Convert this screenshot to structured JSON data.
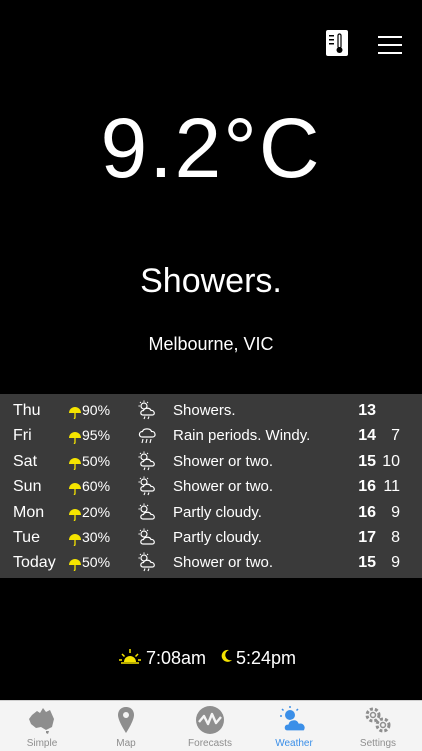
{
  "current": {
    "temperature": "9.2°C",
    "condition": "Showers.",
    "location": "Melbourne, VIC"
  },
  "colors": {
    "accent": "#3b8fe8",
    "umbrella": "#f5e400",
    "forecast_bg": "#3a3a3a"
  },
  "forecast": [
    {
      "day": "Thu",
      "rain": "90%",
      "icon": "showers-icon",
      "desc": "Showers.",
      "max": "13",
      "min": ""
    },
    {
      "day": "Fri",
      "rain": "95%",
      "icon": "rain-icon",
      "desc": "Rain periods. Windy.",
      "max": "14",
      "min": "7"
    },
    {
      "day": "Sat",
      "rain": "50%",
      "icon": "showers-icon",
      "desc": "Shower or two.",
      "max": "15",
      "min": "10"
    },
    {
      "day": "Sun",
      "rain": "60%",
      "icon": "showers-icon",
      "desc": "Shower or two.",
      "max": "16",
      "min": "11"
    },
    {
      "day": "Mon",
      "rain": "20%",
      "icon": "partly-cloudy-icon",
      "desc": "Partly cloudy.",
      "max": "16",
      "min": "9"
    },
    {
      "day": "Tue",
      "rain": "30%",
      "icon": "partly-cloudy-icon",
      "desc": "Partly cloudy.",
      "max": "17",
      "min": "8"
    },
    {
      "day": "Today",
      "rain": "50%",
      "icon": "showers-icon",
      "desc": "Shower or two.",
      "max": "15",
      "min": "9"
    }
  ],
  "sun": {
    "sunrise": "7:08am",
    "sunset": "5:24pm"
  },
  "tabs": [
    {
      "label": "Simple",
      "icon": "australia-map-icon"
    },
    {
      "label": "Map",
      "icon": "map-pin-icon"
    },
    {
      "label": "Forecasts",
      "icon": "forecasts-icon"
    },
    {
      "label": "Weather",
      "icon": "cloud-sun-icon",
      "active": true
    },
    {
      "label": "Settings",
      "icon": "gears-icon"
    }
  ]
}
